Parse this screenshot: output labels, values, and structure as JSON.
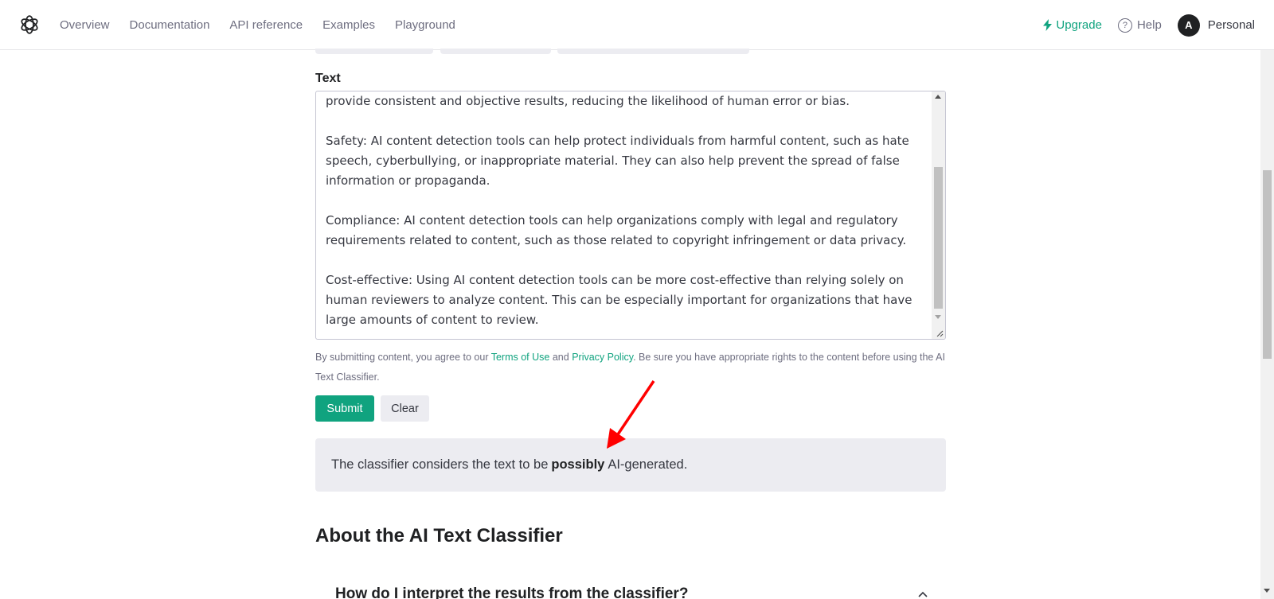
{
  "nav": {
    "items": [
      "Overview",
      "Documentation",
      "API reference",
      "Examples",
      "Playground"
    ],
    "upgrade": "Upgrade",
    "help": "Help",
    "help_glyph": "?",
    "avatar_initial": "A",
    "account": "Personal"
  },
  "form": {
    "text_label": "Text",
    "paragraphs": [
      "provide consistent and objective results, reducing the likelihood of human error or bias.",
      "Safety: AI content detection tools can help protect individuals from harmful content, such as hate speech, cyberbullying, or inappropriate material. They can also help prevent the spread of false information or propaganda.",
      "Compliance: AI content detection tools can help organizations comply with legal and regulatory requirements related to content, such as those related to copyright infringement or data privacy.",
      "Cost-effective: Using AI content detection tools can be more cost-effective than relying solely on human reviewers to analyze content. This can be especially important for organizations that have large amounts of content to review."
    ],
    "terms_prefix": "By submitting content, you agree to our ",
    "terms_link": "Terms of Use",
    "terms_and": " and ",
    "privacy_link": "Privacy Policy",
    "terms_suffix": ". Be sure you have appropriate rights to the content before using the AI Text Classifier.",
    "submit": "Submit",
    "clear": "Clear"
  },
  "result": {
    "prefix": "The classifier considers the text to be",
    "emphasis": "possibly",
    "suffix": "AI-generated."
  },
  "about": {
    "heading": "About the AI Text Classifier",
    "faq_question": "How do I interpret the results from the classifier?"
  },
  "colors": {
    "accent": "#10a37f",
    "annotation_arrow": "#ff0000"
  }
}
